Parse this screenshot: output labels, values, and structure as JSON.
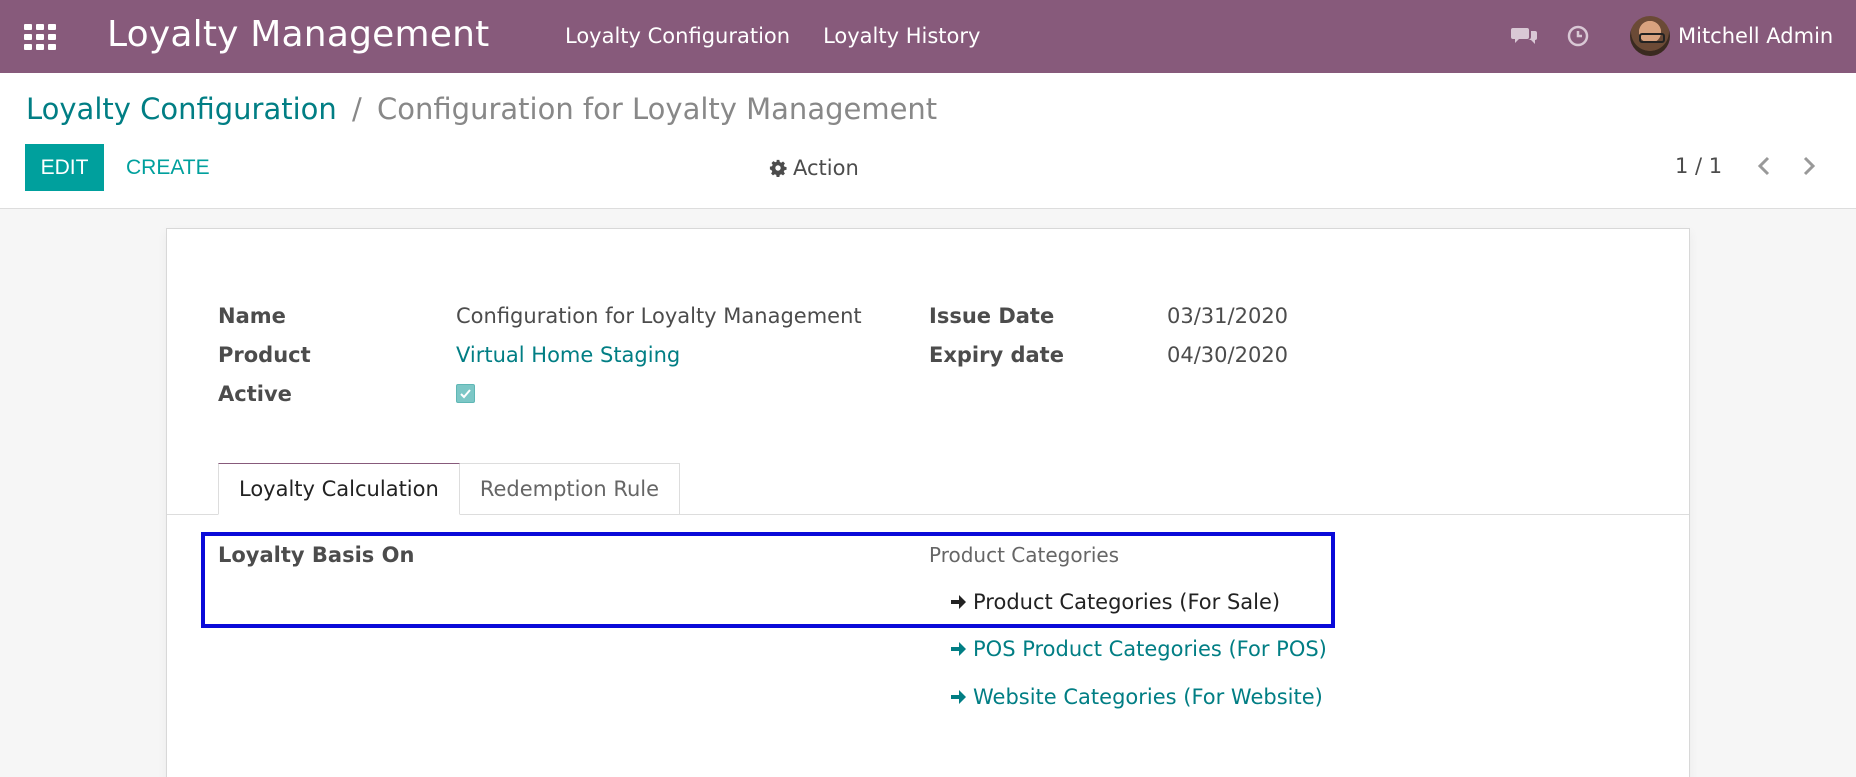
{
  "navbar": {
    "app_title": "Loyalty Management",
    "menu": [
      "Loyalty Configuration",
      "Loyalty History"
    ],
    "user_name": "Mitchell Admin",
    "color": "#875a7b"
  },
  "breadcrumb": {
    "parent": "Loyalty Configuration",
    "separator": "/",
    "current": "Configuration for Loyalty Management"
  },
  "toolbar": {
    "edit_label": "EDIT",
    "create_label": "CREATE",
    "action_label": "Action",
    "pager": "1 / 1"
  },
  "form": {
    "name_label": "Name",
    "name_value": "Configuration for Loyalty Management",
    "product_label": "Product",
    "product_value": "Virtual Home Staging",
    "active_label": "Active",
    "active_value": true,
    "issue_date_label": "Issue Date",
    "issue_date_value": "03/31/2020",
    "expiry_date_label": "Expiry date",
    "expiry_date_value": "04/30/2020"
  },
  "tabs": [
    "Loyalty Calculation",
    "Redemption Rule"
  ],
  "loyalty_calculation": {
    "basis_label": "Loyalty Basis On",
    "options_title": "Product Categories",
    "options": [
      {
        "label": "Product Categories (For Sale)",
        "selected": true
      },
      {
        "label": "POS Product Categories (For POS)",
        "selected": false
      },
      {
        "label": "Website Categories (For Website)",
        "selected": false
      }
    ]
  },
  "colors": {
    "accent": "#00a09d",
    "link": "#017e84",
    "highlight": "#0a0ad9"
  }
}
